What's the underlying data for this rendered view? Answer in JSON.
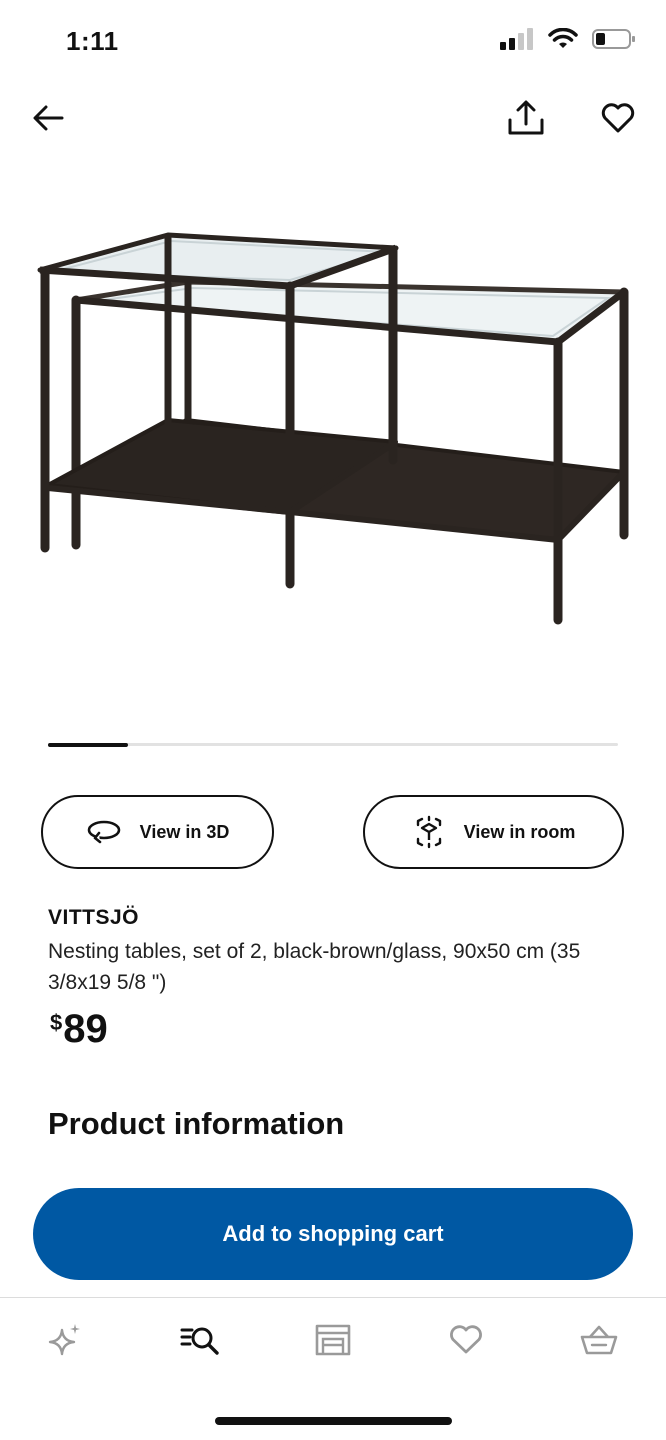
{
  "status_bar": {
    "time": "1:11"
  },
  "product": {
    "name": "VITTSJÖ",
    "description": "Nesting tables, set of 2, black-brown/glass, 90x50 cm (35 3/8x19 5/8 \")",
    "price_currency": "$",
    "price_amount": "89",
    "image_icon": "nesting-tables-image"
  },
  "carousel": {
    "progress": 0.14
  },
  "actions": {
    "view_3d_label": "View in 3D",
    "view_room_label": "View in room"
  },
  "section": {
    "product_info_heading": "Product information"
  },
  "cta": {
    "label": "Add to shopping cart",
    "color": "#0058a3"
  },
  "tabbar": {
    "items": [
      "sparkle-icon",
      "search-icon",
      "store-icon",
      "heart-icon",
      "basket-icon"
    ],
    "active_index": 1
  }
}
